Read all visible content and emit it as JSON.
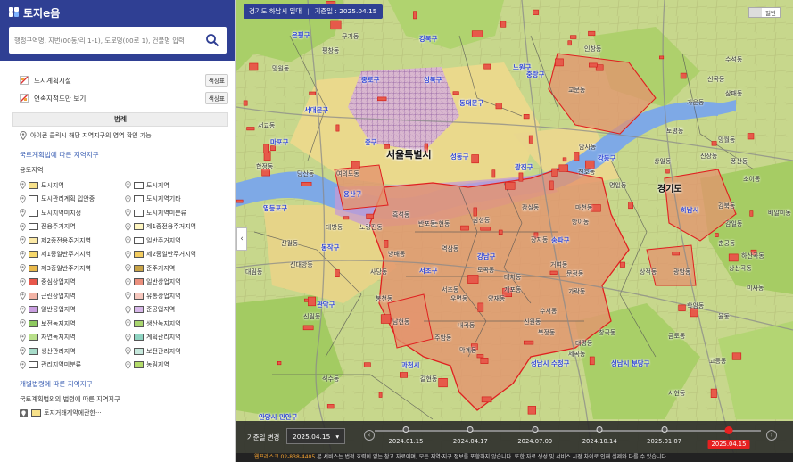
{
  "app": {
    "title": "토지e음"
  },
  "search": {
    "placeholder": "행정구역명, 지번(00동/리 1-1), 도로명(00로 1), 건물명 입력"
  },
  "layers": [
    {
      "label": "도시계획시설",
      "button": "색상표"
    },
    {
      "label": "연속지적도만 보기",
      "button": "색상표"
    }
  ],
  "legend": {
    "title": "범례",
    "note": "아이콘 클릭시 해당 지역지구의 영역 확인 가능",
    "section1": "국토계획법에 따른 지역지구",
    "subsection1": "용도지역",
    "zones": [
      {
        "label": "도시지역",
        "color": "#f7e18a"
      },
      {
        "label": "도시지역",
        "color": "#ffffff"
      },
      {
        "label": "도시관리계획 입안중",
        "color": "#ffffff"
      },
      {
        "label": "도시지역기타",
        "color": "#ffffff"
      },
      {
        "label": "도시지역미지정",
        "color": "#ffffff"
      },
      {
        "label": "도시지역미분류",
        "color": "#ffffff"
      },
      {
        "label": "전용주거지역",
        "color": "#ffffff"
      },
      {
        "label": "제1종전용주거지역",
        "color": "#fff6c0"
      },
      {
        "label": "제2종전용주거지역",
        "color": "#fbe9a6"
      },
      {
        "label": "일반주거지역",
        "color": "#ffffff"
      },
      {
        "label": "제1종일반주거지역",
        "color": "#f5d76b"
      },
      {
        "label": "제2종일반주거지역",
        "color": "#f3cc60"
      },
      {
        "label": "제3종일반주거지역",
        "color": "#e9b94b"
      },
      {
        "label": "준주거지역",
        "color": "#c9a447"
      },
      {
        "label": "중심상업지역",
        "color": "#e8574b"
      },
      {
        "label": "일반상업지역",
        "color": "#ea8f7d"
      },
      {
        "label": "근린상업지역",
        "color": "#f2b3a5"
      },
      {
        "label": "유통상업지역",
        "color": "#f6c7bd"
      },
      {
        "label": "일반공업지역",
        "color": "#c99ee0"
      },
      {
        "label": "준공업지역",
        "color": "#d8b8ea"
      },
      {
        "label": "보전녹지지역",
        "color": "#8ec95f"
      },
      {
        "label": "생산녹지지역",
        "color": "#a9d66f"
      },
      {
        "label": "자연녹지지역",
        "color": "#b9e08a"
      },
      {
        "label": "계획관리지역",
        "color": "#8fd4c2"
      },
      {
        "label": "생산관리지역",
        "color": "#a7dbc9"
      },
      {
        "label": "보전관리지역",
        "color": "#c6e8dc"
      },
      {
        "label": "관리지역미분류",
        "color": "#ffffff"
      },
      {
        "label": "농림지역",
        "color": "#b3db6a"
      }
    ],
    "section2": "개별법령에 따른 지역지구",
    "subsection2": "국토계획법외의 법령에 따른 지역지구",
    "trade": {
      "label": "토지거래계약에관한···",
      "color": "#f7e18a"
    }
  },
  "map": {
    "region": "경기도 하남시 일대",
    "base_date": "기준일 : 2025.04.15",
    "basemap": "일반",
    "labels": {
      "seoul": "서울특별시",
      "gyeonggi": "경기도",
      "gu": [
        "은평구",
        "종로구",
        "성북구",
        "강북구",
        "노원구",
        "서대문구",
        "동대문구",
        "중랑구",
        "마포구",
        "중구",
        "성동구",
        "광진구",
        "용산구",
        "강동구",
        "영등포구",
        "동작구",
        "서초구",
        "강남구",
        "송파구",
        "관악구",
        "하남시",
        "과천시",
        "안양시 만안구",
        "성남시 수정구",
        "성남시 분당구"
      ],
      "dong": [
        "구기동",
        "평창동",
        "인창동",
        "교문동",
        "수석동",
        "신곡동",
        "삼패동",
        "가운동",
        "토평동",
        "암사동",
        "천호동",
        "상일동",
        "명일동",
        "망월동",
        "신장동",
        "풍산동",
        "초이동",
        "감북동",
        "감일동",
        "마천동",
        "장지동",
        "거여동",
        "문정동",
        "가락동",
        "방이동",
        "잠실동",
        "삼성동",
        "역삼동",
        "논현동",
        "도곡동",
        "개포동",
        "대치동",
        "수서동",
        "세곡동",
        "신원동",
        "내곡동",
        "우면동",
        "양재동",
        "서초동",
        "반포동",
        "방배동",
        "사당동",
        "흑석동",
        "노량진동",
        "대방동",
        "신대방동",
        "봉천동",
        "신림동",
        "남현동",
        "주암동",
        "막계동",
        "갈현동",
        "복정동",
        "창곡동",
        "태평동",
        "상적동",
        "금토동",
        "고등동",
        "학암동",
        "율동",
        "서현동",
        "하산곡동",
        "상산곡동",
        "춘궁동",
        "광암동",
        "배알미동",
        "미사동",
        "망원동",
        "서교동",
        "합정동",
        "당산동",
        "여의도동",
        "신길동",
        "대림동",
        "석수동"
      ]
    },
    "timeline": {
      "label": "기준일 변경",
      "selected": "2025.04.15",
      "dates": [
        "2024.01.15",
        "2024.04.17",
        "2024.07.09",
        "2024.10.14",
        "2025.01.07",
        "2025.04.15"
      ]
    },
    "footer": {
      "phone": "웹프레스크 02-838-4405",
      "text": "본 서비스는 법적 효력이 없는 참고 자료이며, 모든 지역·지구 정보를 포함하지 않습니다. 또한 자료 생성 및 서비스 시점 차이로 인해 실제와 다를 수 있습니다."
    }
  }
}
